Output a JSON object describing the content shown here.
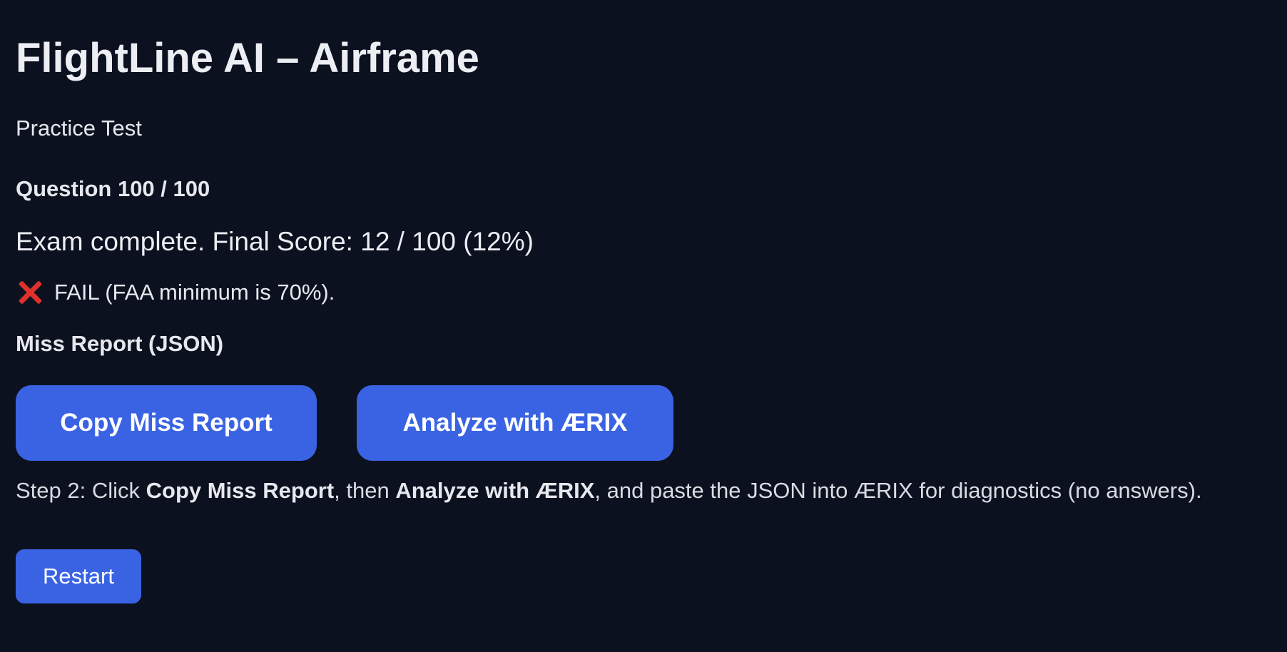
{
  "header": {
    "title": "FlightLine AI – Airframe",
    "subtitle": "Practice Test"
  },
  "exam": {
    "question_counter": "Question 100 / 100",
    "score_text": "Exam complete. Final Score: 12 / 100 (12%)",
    "result_icon": "cross-mark-icon",
    "result_icon_color": "#e0302c",
    "result_text": "FAIL (FAA minimum is 70%)."
  },
  "report": {
    "heading": "Miss Report (JSON)",
    "copy_label": "Copy Miss Report",
    "analyze_label": "Analyze with ÆRIX",
    "step": {
      "prefix": "Step 2: Click ",
      "copy_ref": "Copy Miss Report",
      "middle": ", then ",
      "analyze_ref": "Analyze with ÆRIX",
      "suffix": ", and paste the JSON into ÆRIX for diagnostics (no answers)."
    }
  },
  "actions": {
    "restart_label": "Restart"
  },
  "colors": {
    "background": "#0c111f",
    "button": "#3a63e4",
    "text": "#e8e9ee"
  }
}
